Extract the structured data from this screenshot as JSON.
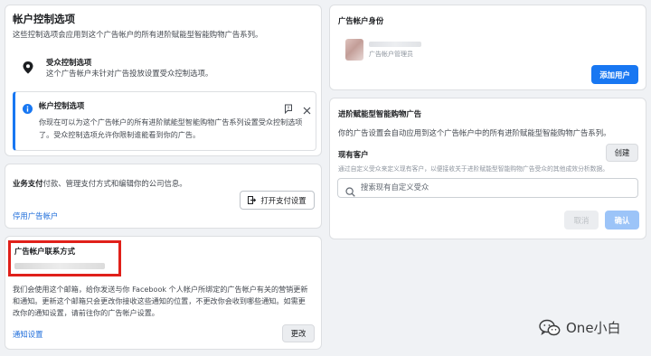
{
  "account_controls": {
    "title": "帐户控制选项",
    "description": "这些控制选项会应用到这个广告帐户的所有进阶赋能型智能购物广告系列。",
    "audience_control": {
      "title": "受众控制选项",
      "description": "这个广告帐户未针对广告投放设置受众控制选项。"
    },
    "notice": {
      "title": "帐户控制选项",
      "line1": "你现在可以为这个广告帐户的所有进阶赋能型智能购物广告系列设置受众控制选项",
      "line2": "了。受众控制选项允许你限制谁能看到你的广告。"
    }
  },
  "business_payment": {
    "title": "业务支付",
    "description": "付款、管理支付方式和编辑你的公司信息。",
    "open_button": "打开支付设置",
    "disable_link": "停用广告帐户"
  },
  "contact": {
    "title": "广告帐户联系方式",
    "line1": "我们会使用这个邮箱，给你发送与你 Facebook 个人帐户所绑定的广告帐户有关的营销更新",
    "line2": "和通知。更新这个邮箱只会更改你接收这些通知的位置，不更改你会收到哪些通知。如需更",
    "line3": "改你的通知设置，请前往你的广告帐户设置。",
    "notification_link": "通知设置",
    "change_button": "更改"
  },
  "identity": {
    "title": "广告帐户身份",
    "role": "广告帐户管理员",
    "add_user_button": "添加用户"
  },
  "advantage": {
    "title": "进阶赋能型智能购物广告",
    "description": "你的广告设置会自动应用到这个广告帐户中的所有进阶赋能型智能购物广告系列。",
    "existing_customers_label": "现有客户",
    "existing_customers_hint": "通过自定义受众来定义现有客户，以便接收关于进阶赋能型智能购物广告受众的其他成效分析数据。",
    "create_button": "创建",
    "search_placeholder": "搜索现有自定义受众",
    "cancel_button": "取消",
    "confirm_button": "确认"
  },
  "watermark": {
    "text": "One小白"
  },
  "colors": {
    "accent": "#1877f2",
    "highlight_box": "#e0201a",
    "page_bg": "#f0f2f5"
  }
}
